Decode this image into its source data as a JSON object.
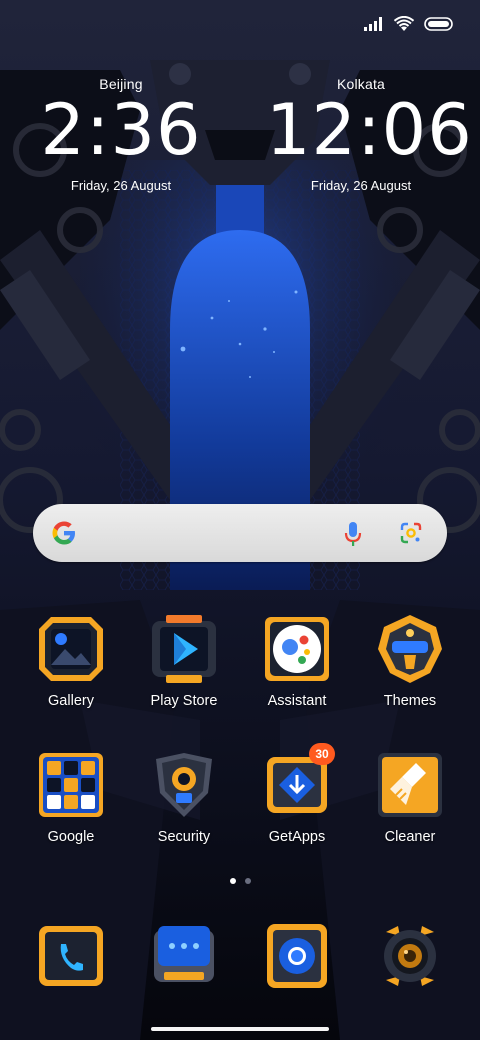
{
  "clocks": [
    {
      "city": "Beijing",
      "time": "2:36",
      "date": "Friday, 26 August"
    },
    {
      "city": "Kolkata",
      "time": "12:06",
      "date": "Friday, 26 August"
    }
  ],
  "status_bar": {
    "icons": [
      "signal-icon",
      "wifi-icon",
      "battery-icon"
    ]
  },
  "search": {
    "icons": [
      "google-logo-icon",
      "microphone-icon",
      "lens-icon"
    ]
  },
  "apps": [
    {
      "label": "Gallery",
      "icon": "gallery-icon"
    },
    {
      "label": "Play Store",
      "icon": "play-store-icon"
    },
    {
      "label": "Assistant",
      "icon": "assistant-icon"
    },
    {
      "label": "Themes",
      "icon": "themes-icon"
    },
    {
      "label": "Google",
      "icon": "google-folder-icon"
    },
    {
      "label": "Security",
      "icon": "security-icon"
    },
    {
      "label": "GetApps",
      "icon": "getapps-icon",
      "badge": "30"
    },
    {
      "label": "Cleaner",
      "icon": "cleaner-icon"
    }
  ],
  "dock": [
    {
      "icon": "phone-icon"
    },
    {
      "icon": "messages-icon"
    },
    {
      "icon": "chrome-icon"
    },
    {
      "icon": "camera-icon"
    }
  ],
  "pages": {
    "count": 2,
    "active": 1
  },
  "colors": {
    "accent_orange": "#f5a623",
    "accent_blue": "#2f7bff",
    "badge": "#ff5a1f",
    "icon_dark": "#1c2230"
  }
}
